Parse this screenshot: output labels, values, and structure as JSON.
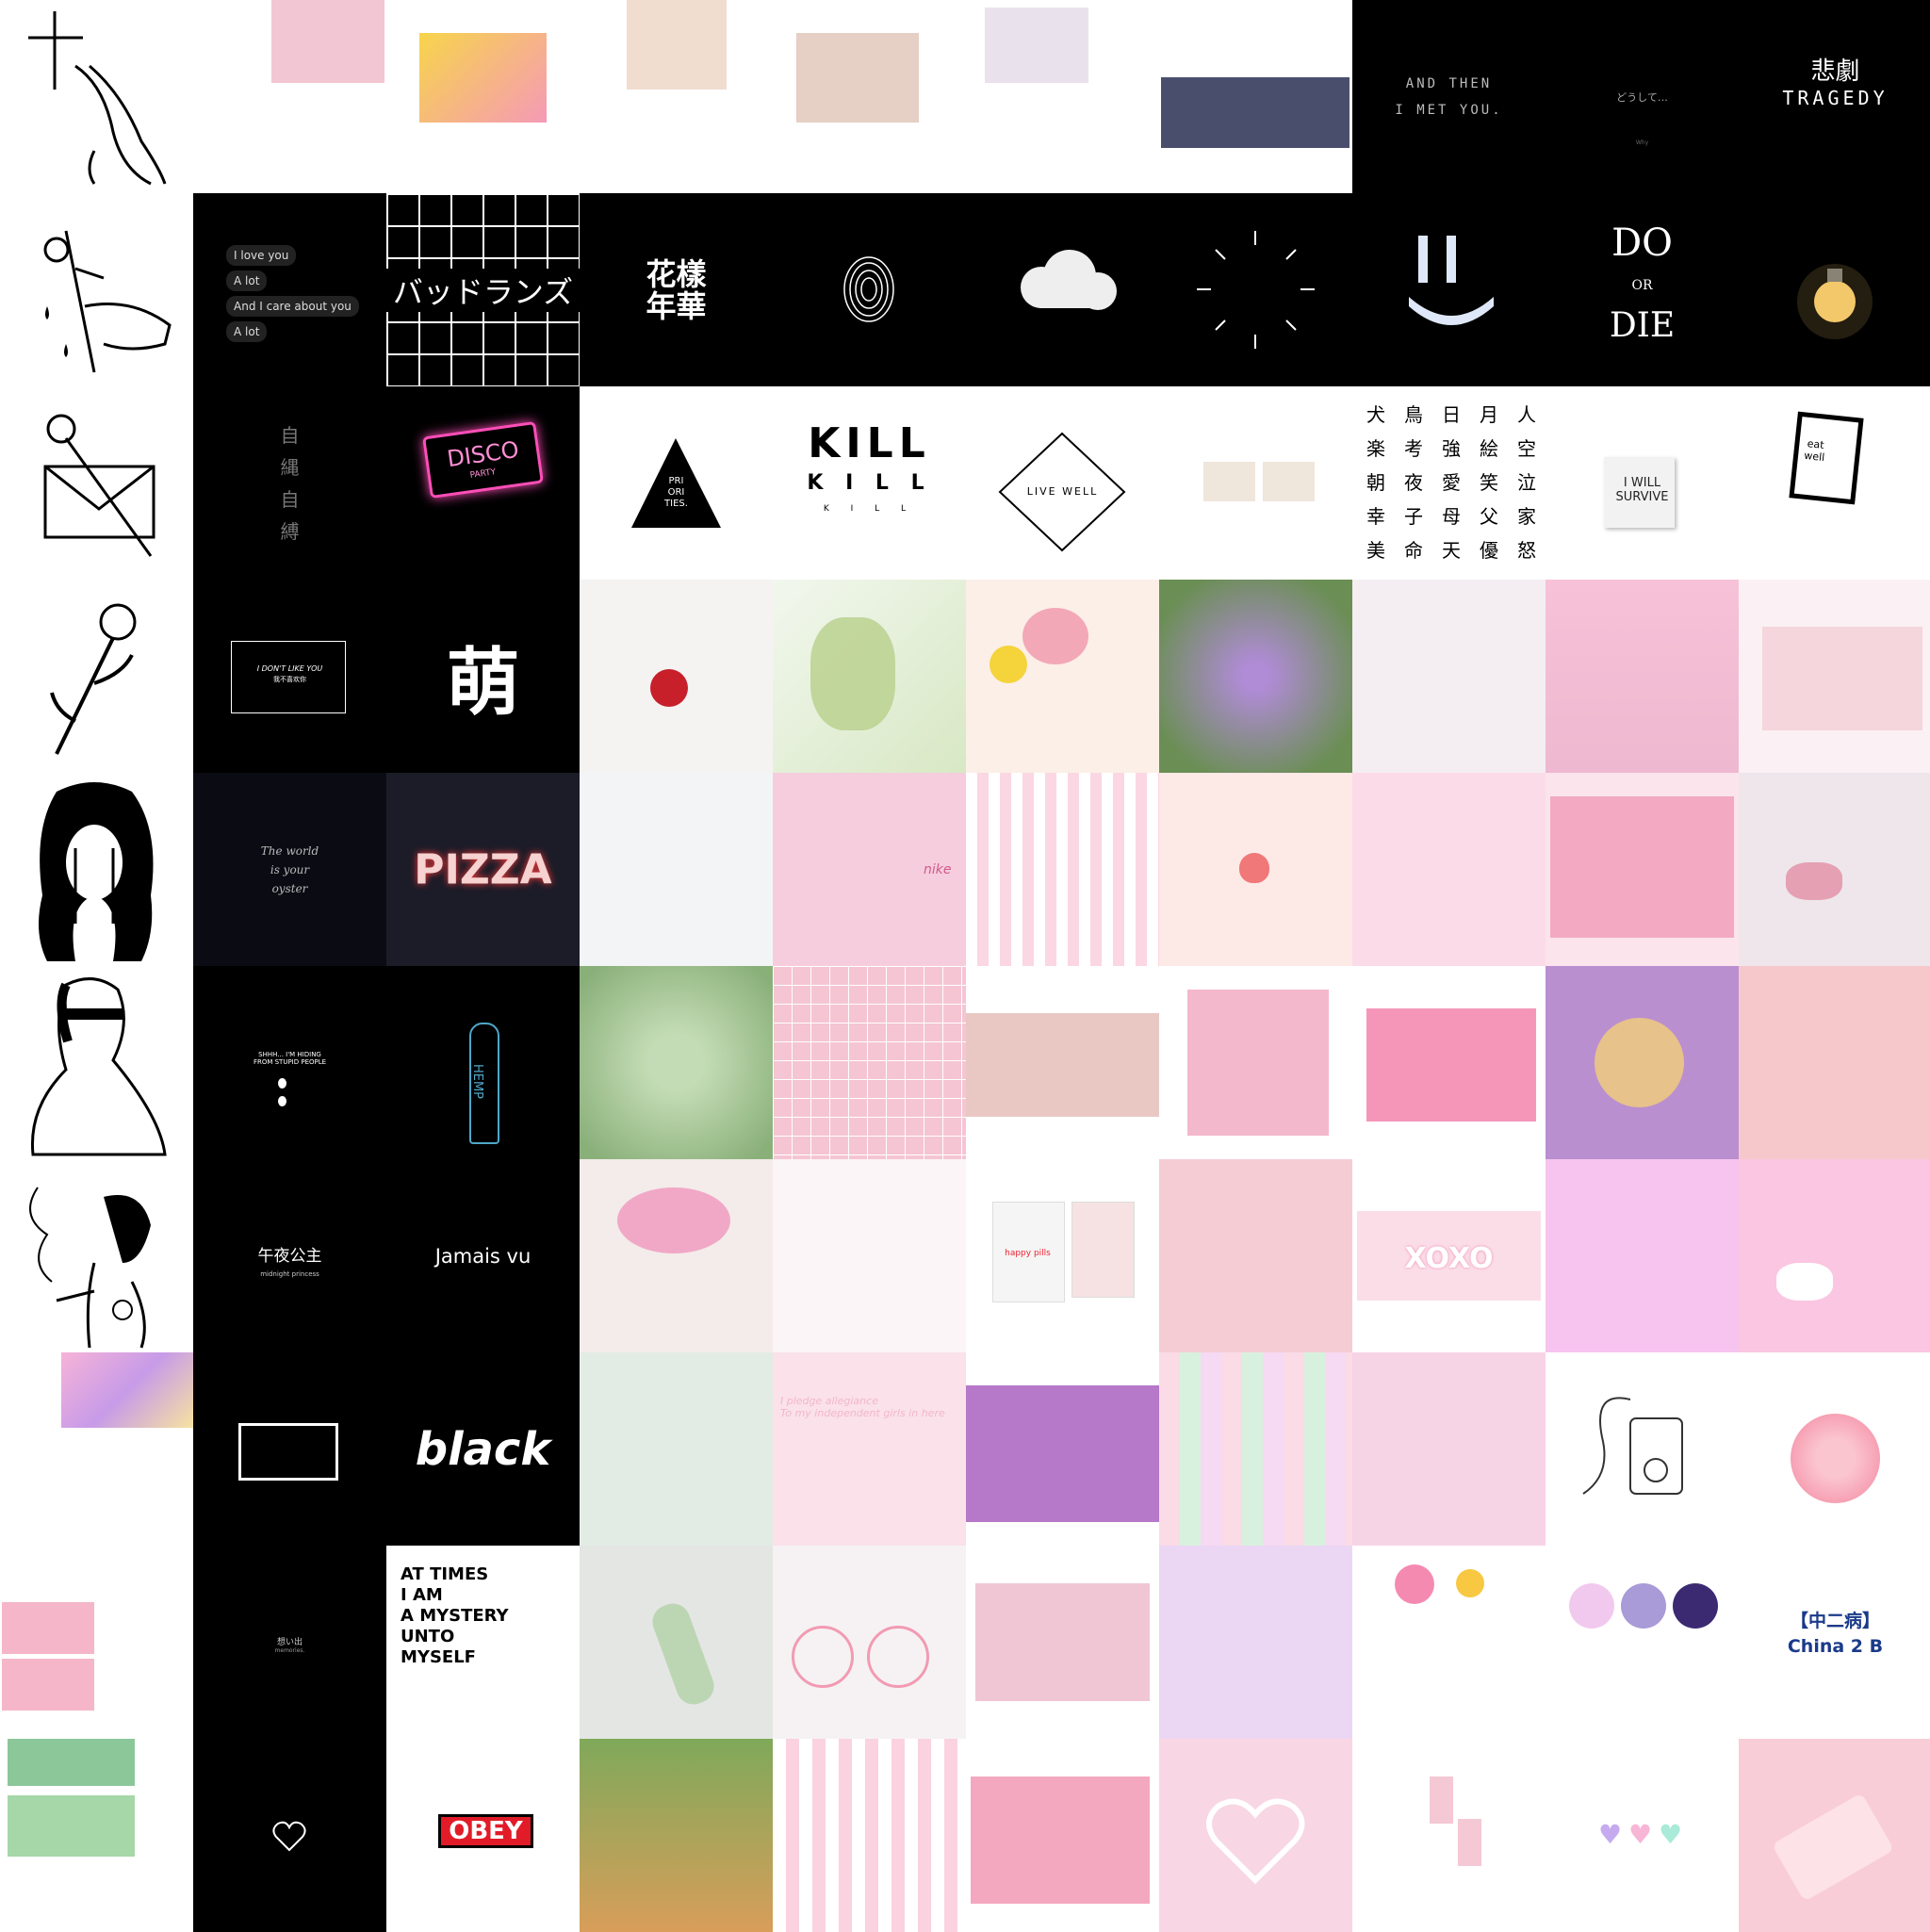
{
  "colors": {
    "black": "#000000",
    "white": "#ffffff",
    "pink": "#f6cddd",
    "pale_pink": "#fbe3ec",
    "hot_pink": "#ff3c8a",
    "navy_text": "#1a3a8a"
  },
  "tiles": {
    "and_then": "AND THEN\nI MET YOU.",
    "doushite": "どうして…",
    "doushite_sub": "Why",
    "tragedy_cn": "悲劇",
    "tragedy_en": "TRAGEDY",
    "love_lines": [
      "I love you",
      "A lot",
      "And I care about you",
      "A lot"
    ],
    "badlands": "バッドランズ",
    "huayang": "花樣\n年華",
    "do_or_die_1": "DO",
    "do_or_die_2": "OR",
    "do_or_die_3": "DIE",
    "zibai": "自\n縄\n自\n縛",
    "disco": "DISCO",
    "disco_sub": "PARTY",
    "priorities": "PRI\nORI\nTIES.",
    "kill_big": "KILL",
    "kill_mid": "K I L L",
    "kill_sm": "K  I  L  L",
    "live_well": "LIVE WELL",
    "kanji_cols": [
      "犬楽朝幸美",
      "鳥考夜子命",
      "日強愛母天",
      "月絵笑父優",
      "人空泣家怒"
    ],
    "i_will_survive": "I WILL\nSURVIVE",
    "eat_well": "eat\nwell",
    "dont_like": "I DON'T LIKE YOU",
    "dont_like_sub": "我不喜欢你",
    "meng": "萌",
    "world_oyster": "The world\nis your\noyster",
    "pizza": "PIZZA",
    "nike": "nike",
    "shhh": "SHHH... I'M HIDING\nFROM STUPID PEOPLE",
    "hemp": "HEMP",
    "midnight_cn": "午夜公主",
    "midnight_en": "midnight princess",
    "jamais_vu": "Jamais vu",
    "happy_pills": "happy pills",
    "xoxo": "XOXO",
    "black": "black",
    "pledge": "I pledge allegiance\nTo my independent girls in here",
    "omoide": "想い出",
    "memories": "memories.",
    "at_times": "AT TIMES\nI AM\nA MYSTERY\nUNTO\nMYSELF",
    "chuunibyou": "【中二病】",
    "china2b": "China 2 B",
    "obey": "OBEY"
  }
}
